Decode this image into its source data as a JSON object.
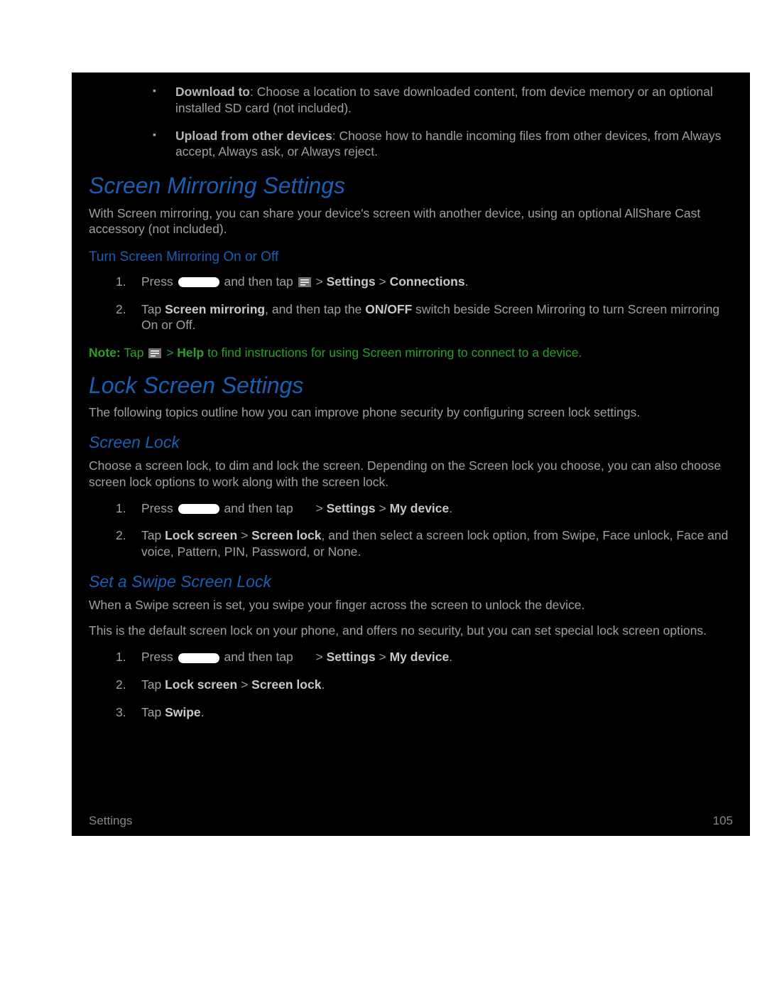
{
  "bullets": [
    {
      "label": "Download to",
      "text": ": Choose a location to save downloaded content, from device memory or an optional installed SD card (not included)."
    },
    {
      "label": "Upload from other devices",
      "text": ": Choose how to handle incoming files from other devices, from Always accept, Always ask, or Always reject."
    }
  ],
  "h1_mirroring": "Screen Mirroring Settings",
  "p_mirroring": "With Screen mirroring, you can share your device's screen with another device, using an optional AllShare Cast accessory (not included).",
  "h3_turn": "Turn Screen Mirroring On or Off",
  "mirror_steps": {
    "s1_a": "Press ",
    "s1_b": " and then tap ",
    "s1_c": " > ",
    "s1_d": "Settings",
    "s1_e": " > ",
    "s1_f": "Connections",
    "s1_g": ".",
    "s2_a": "Tap ",
    "s2_b": "Screen mirroring",
    "s2_c": ", and then tap the ",
    "s2_d": "ON/OFF",
    "s2_e": " switch beside Screen Mirroring to turn Screen mirroring On or Off."
  },
  "note": {
    "label": "Note:",
    "a": " Tap ",
    "b": " > ",
    "c": "Help",
    "d": " to find instructions for using Screen mirroring to connect to a device."
  },
  "h1_lock": "Lock Screen Settings",
  "p_lock": "The following topics outline how you can improve phone security by configuring screen lock settings.",
  "h2_screenlock": "Screen Lock",
  "p_screenlock": "Choose a screen lock, to dim and lock the screen. Depending on the Screen lock you choose, you can also choose screen lock options to work along with the screen lock.",
  "lock_steps": {
    "s1_a": "Press ",
    "s1_b": " and then tap ",
    "s1_c": " > ",
    "s1_d": "Settings",
    "s1_e": " > ",
    "s1_f": "My device",
    "s1_g": ".",
    "s2_a": "Tap ",
    "s2_b": "Lock screen",
    "s2_c": " > ",
    "s2_d": "Screen lock",
    "s2_e": ", and then select a screen lock option, from Swipe, Face unlock, Face and voice, Pattern, PIN, Password, or None."
  },
  "h2_swipe": "Set a Swipe Screen Lock",
  "p_swipe1": "When a Swipe screen is set, you swipe your finger across the screen to unlock the device.",
  "p_swipe2": "This is the default screen lock on your phone, and offers no security, but you can set special lock screen options.",
  "swipe_steps": {
    "s1_a": "Press ",
    "s1_b": " and then tap ",
    "s1_c": " > ",
    "s1_d": "Settings",
    "s1_e": " > ",
    "s1_f": "My device",
    "s1_g": ".",
    "s2_a": "Tap ",
    "s2_b": "Lock screen",
    "s2_c": " > ",
    "s2_d": "Screen lock",
    "s2_e": ".",
    "s3_a": "Tap ",
    "s3_b": "Swipe",
    "s3_c": "."
  },
  "footer_left": "Settings",
  "footer_right": "105"
}
